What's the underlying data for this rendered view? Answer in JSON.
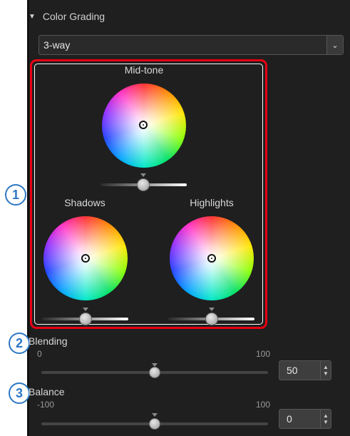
{
  "panel": {
    "section_title": "Color Grading",
    "collapse_icon": "triangle-down-icon"
  },
  "mode_select": {
    "value": "3-way"
  },
  "wheels": {
    "midtone": {
      "label": "Mid-tone"
    },
    "shadows": {
      "label": "Shadows"
    },
    "highlights": {
      "label": "Highlights"
    }
  },
  "callouts": [
    "1",
    "2",
    "3"
  ],
  "blending": {
    "label": "Blending",
    "min_label": "0",
    "max_label": "100",
    "value": "50",
    "position": 0.5
  },
  "balance": {
    "label": "Balance",
    "min_label": "-100",
    "max_label": "100",
    "value": "0",
    "position": 0.5
  },
  "colors": {
    "panel_bg": "#1f1f1f",
    "highlight_border": "#e60012",
    "callout_blue": "#2d78c4"
  }
}
